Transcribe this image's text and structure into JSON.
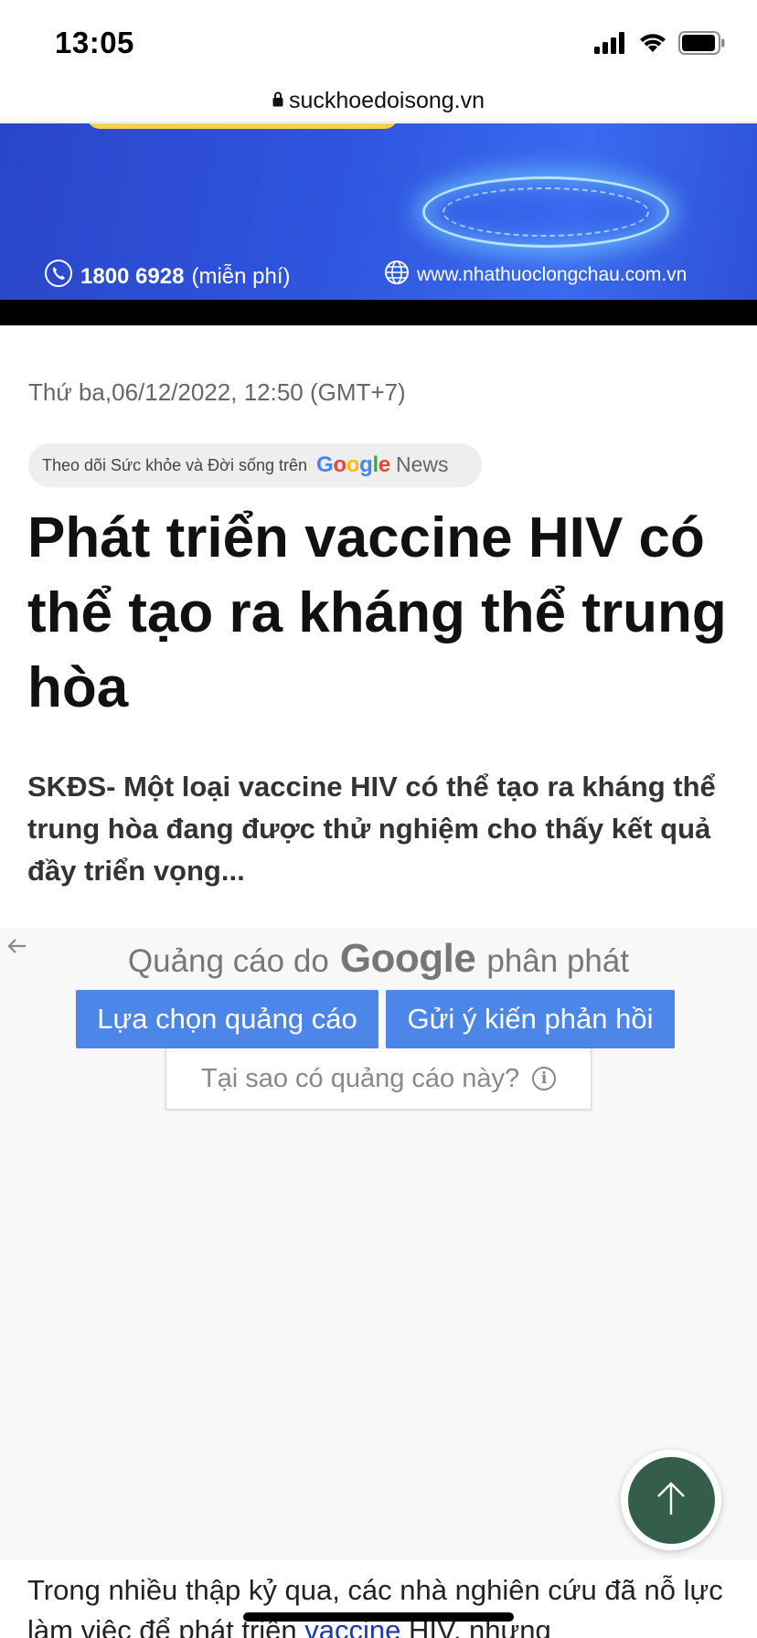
{
  "status_bar": {
    "time": "13:05",
    "signal_icon": "cellular-signal-icon",
    "wifi_icon": "wifi-icon",
    "battery_icon": "battery-icon"
  },
  "browser": {
    "url": "suckhoedoisong.vn",
    "lock_icon": "lock-icon"
  },
  "banner": {
    "phone_number": "1800 6928",
    "phone_note": "(miễn phí)",
    "website": "www.nhathuoclongchau.com.vn",
    "phone_icon": "phone-icon",
    "globe_icon": "globe-icon"
  },
  "article": {
    "date": "Thứ ba,06/12/2022, 12:50 (GMT+7)",
    "follow_text": "Theo dõi Sức khỏe và Đời sống trên",
    "google_letters": [
      "G",
      "o",
      "o",
      "g",
      "l",
      "e"
    ],
    "google_colors": [
      "#4285F4",
      "#EA4335",
      "#FBBC05",
      "#4285F4",
      "#34A853",
      "#EA4335"
    ],
    "news_label": "News",
    "headline": "Phát triển vaccine HIV có thể tạo ra kháng thể trung hòa",
    "sapo": "SKĐS- Một loại vaccine HIV có thể tạo ra kháng thể trung hòa đang được thử nghiệm cho thấy kết quả đầy triển vọng...",
    "body_before_link": "Trong nhiều thập kỷ qua, các nhà nghiên cứu đã nỗ lực làm việc để phát triển ",
    "body_link": "vaccine",
    "body_after_link": " HIV, nhưng"
  },
  "ad": {
    "served_by_prefix": "Quảng cáo do",
    "served_by_brand": "Google",
    "served_by_suffix": "phân phát",
    "ad_choices_button": "Lựa chọn quảng cáo",
    "feedback_button": "Gửi ý kiến phản hồi",
    "why_this_ad": "Tại sao có quảng cáo này?",
    "back_icon": "back-arrow-icon",
    "info_icon": "info-icon"
  },
  "scroll_top": {
    "icon": "arrow-up-icon",
    "color": "#355e4a"
  }
}
